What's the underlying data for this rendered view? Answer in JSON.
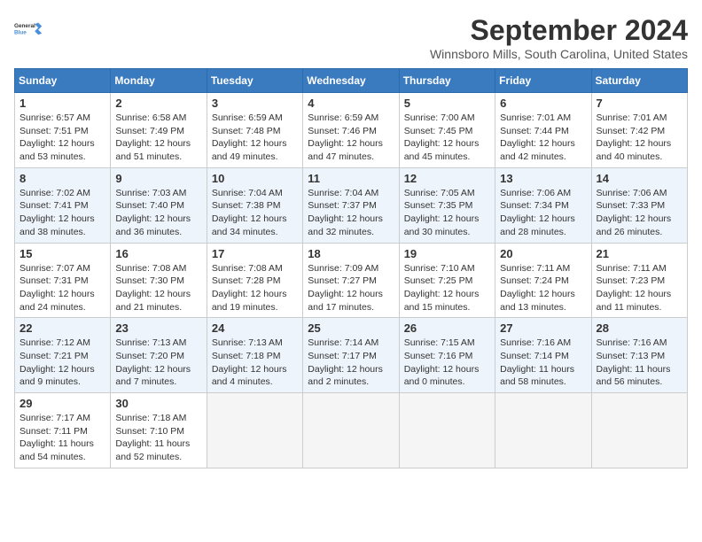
{
  "header": {
    "logo_line1": "General",
    "logo_line2": "Blue",
    "month_title": "September 2024",
    "location": "Winnsboro Mills, South Carolina, United States"
  },
  "weekdays": [
    "Sunday",
    "Monday",
    "Tuesday",
    "Wednesday",
    "Thursday",
    "Friday",
    "Saturday"
  ],
  "weeks": [
    [
      {
        "day": "1",
        "info": "Sunrise: 6:57 AM\nSunset: 7:51 PM\nDaylight: 12 hours\nand 53 minutes."
      },
      {
        "day": "2",
        "info": "Sunrise: 6:58 AM\nSunset: 7:49 PM\nDaylight: 12 hours\nand 51 minutes."
      },
      {
        "day": "3",
        "info": "Sunrise: 6:59 AM\nSunset: 7:48 PM\nDaylight: 12 hours\nand 49 minutes."
      },
      {
        "day": "4",
        "info": "Sunrise: 6:59 AM\nSunset: 7:46 PM\nDaylight: 12 hours\nand 47 minutes."
      },
      {
        "day": "5",
        "info": "Sunrise: 7:00 AM\nSunset: 7:45 PM\nDaylight: 12 hours\nand 45 minutes."
      },
      {
        "day": "6",
        "info": "Sunrise: 7:01 AM\nSunset: 7:44 PM\nDaylight: 12 hours\nand 42 minutes."
      },
      {
        "day": "7",
        "info": "Sunrise: 7:01 AM\nSunset: 7:42 PM\nDaylight: 12 hours\nand 40 minutes."
      }
    ],
    [
      {
        "day": "8",
        "info": "Sunrise: 7:02 AM\nSunset: 7:41 PM\nDaylight: 12 hours\nand 38 minutes."
      },
      {
        "day": "9",
        "info": "Sunrise: 7:03 AM\nSunset: 7:40 PM\nDaylight: 12 hours\nand 36 minutes."
      },
      {
        "day": "10",
        "info": "Sunrise: 7:04 AM\nSunset: 7:38 PM\nDaylight: 12 hours\nand 34 minutes."
      },
      {
        "day": "11",
        "info": "Sunrise: 7:04 AM\nSunset: 7:37 PM\nDaylight: 12 hours\nand 32 minutes."
      },
      {
        "day": "12",
        "info": "Sunrise: 7:05 AM\nSunset: 7:35 PM\nDaylight: 12 hours\nand 30 minutes."
      },
      {
        "day": "13",
        "info": "Sunrise: 7:06 AM\nSunset: 7:34 PM\nDaylight: 12 hours\nand 28 minutes."
      },
      {
        "day": "14",
        "info": "Sunrise: 7:06 AM\nSunset: 7:33 PM\nDaylight: 12 hours\nand 26 minutes."
      }
    ],
    [
      {
        "day": "15",
        "info": "Sunrise: 7:07 AM\nSunset: 7:31 PM\nDaylight: 12 hours\nand 24 minutes."
      },
      {
        "day": "16",
        "info": "Sunrise: 7:08 AM\nSunset: 7:30 PM\nDaylight: 12 hours\nand 21 minutes."
      },
      {
        "day": "17",
        "info": "Sunrise: 7:08 AM\nSunset: 7:28 PM\nDaylight: 12 hours\nand 19 minutes."
      },
      {
        "day": "18",
        "info": "Sunrise: 7:09 AM\nSunset: 7:27 PM\nDaylight: 12 hours\nand 17 minutes."
      },
      {
        "day": "19",
        "info": "Sunrise: 7:10 AM\nSunset: 7:25 PM\nDaylight: 12 hours\nand 15 minutes."
      },
      {
        "day": "20",
        "info": "Sunrise: 7:11 AM\nSunset: 7:24 PM\nDaylight: 12 hours\nand 13 minutes."
      },
      {
        "day": "21",
        "info": "Sunrise: 7:11 AM\nSunset: 7:23 PM\nDaylight: 12 hours\nand 11 minutes."
      }
    ],
    [
      {
        "day": "22",
        "info": "Sunrise: 7:12 AM\nSunset: 7:21 PM\nDaylight: 12 hours\nand 9 minutes."
      },
      {
        "day": "23",
        "info": "Sunrise: 7:13 AM\nSunset: 7:20 PM\nDaylight: 12 hours\nand 7 minutes."
      },
      {
        "day": "24",
        "info": "Sunrise: 7:13 AM\nSunset: 7:18 PM\nDaylight: 12 hours\nand 4 minutes."
      },
      {
        "day": "25",
        "info": "Sunrise: 7:14 AM\nSunset: 7:17 PM\nDaylight: 12 hours\nand 2 minutes."
      },
      {
        "day": "26",
        "info": "Sunrise: 7:15 AM\nSunset: 7:16 PM\nDaylight: 12 hours\nand 0 minutes."
      },
      {
        "day": "27",
        "info": "Sunrise: 7:16 AM\nSunset: 7:14 PM\nDaylight: 11 hours\nand 58 minutes."
      },
      {
        "day": "28",
        "info": "Sunrise: 7:16 AM\nSunset: 7:13 PM\nDaylight: 11 hours\nand 56 minutes."
      }
    ],
    [
      {
        "day": "29",
        "info": "Sunrise: 7:17 AM\nSunset: 7:11 PM\nDaylight: 11 hours\nand 54 minutes."
      },
      {
        "day": "30",
        "info": "Sunrise: 7:18 AM\nSunset: 7:10 PM\nDaylight: 11 hours\nand 52 minutes."
      },
      {
        "day": "",
        "info": ""
      },
      {
        "day": "",
        "info": ""
      },
      {
        "day": "",
        "info": ""
      },
      {
        "day": "",
        "info": ""
      },
      {
        "day": "",
        "info": ""
      }
    ]
  ]
}
